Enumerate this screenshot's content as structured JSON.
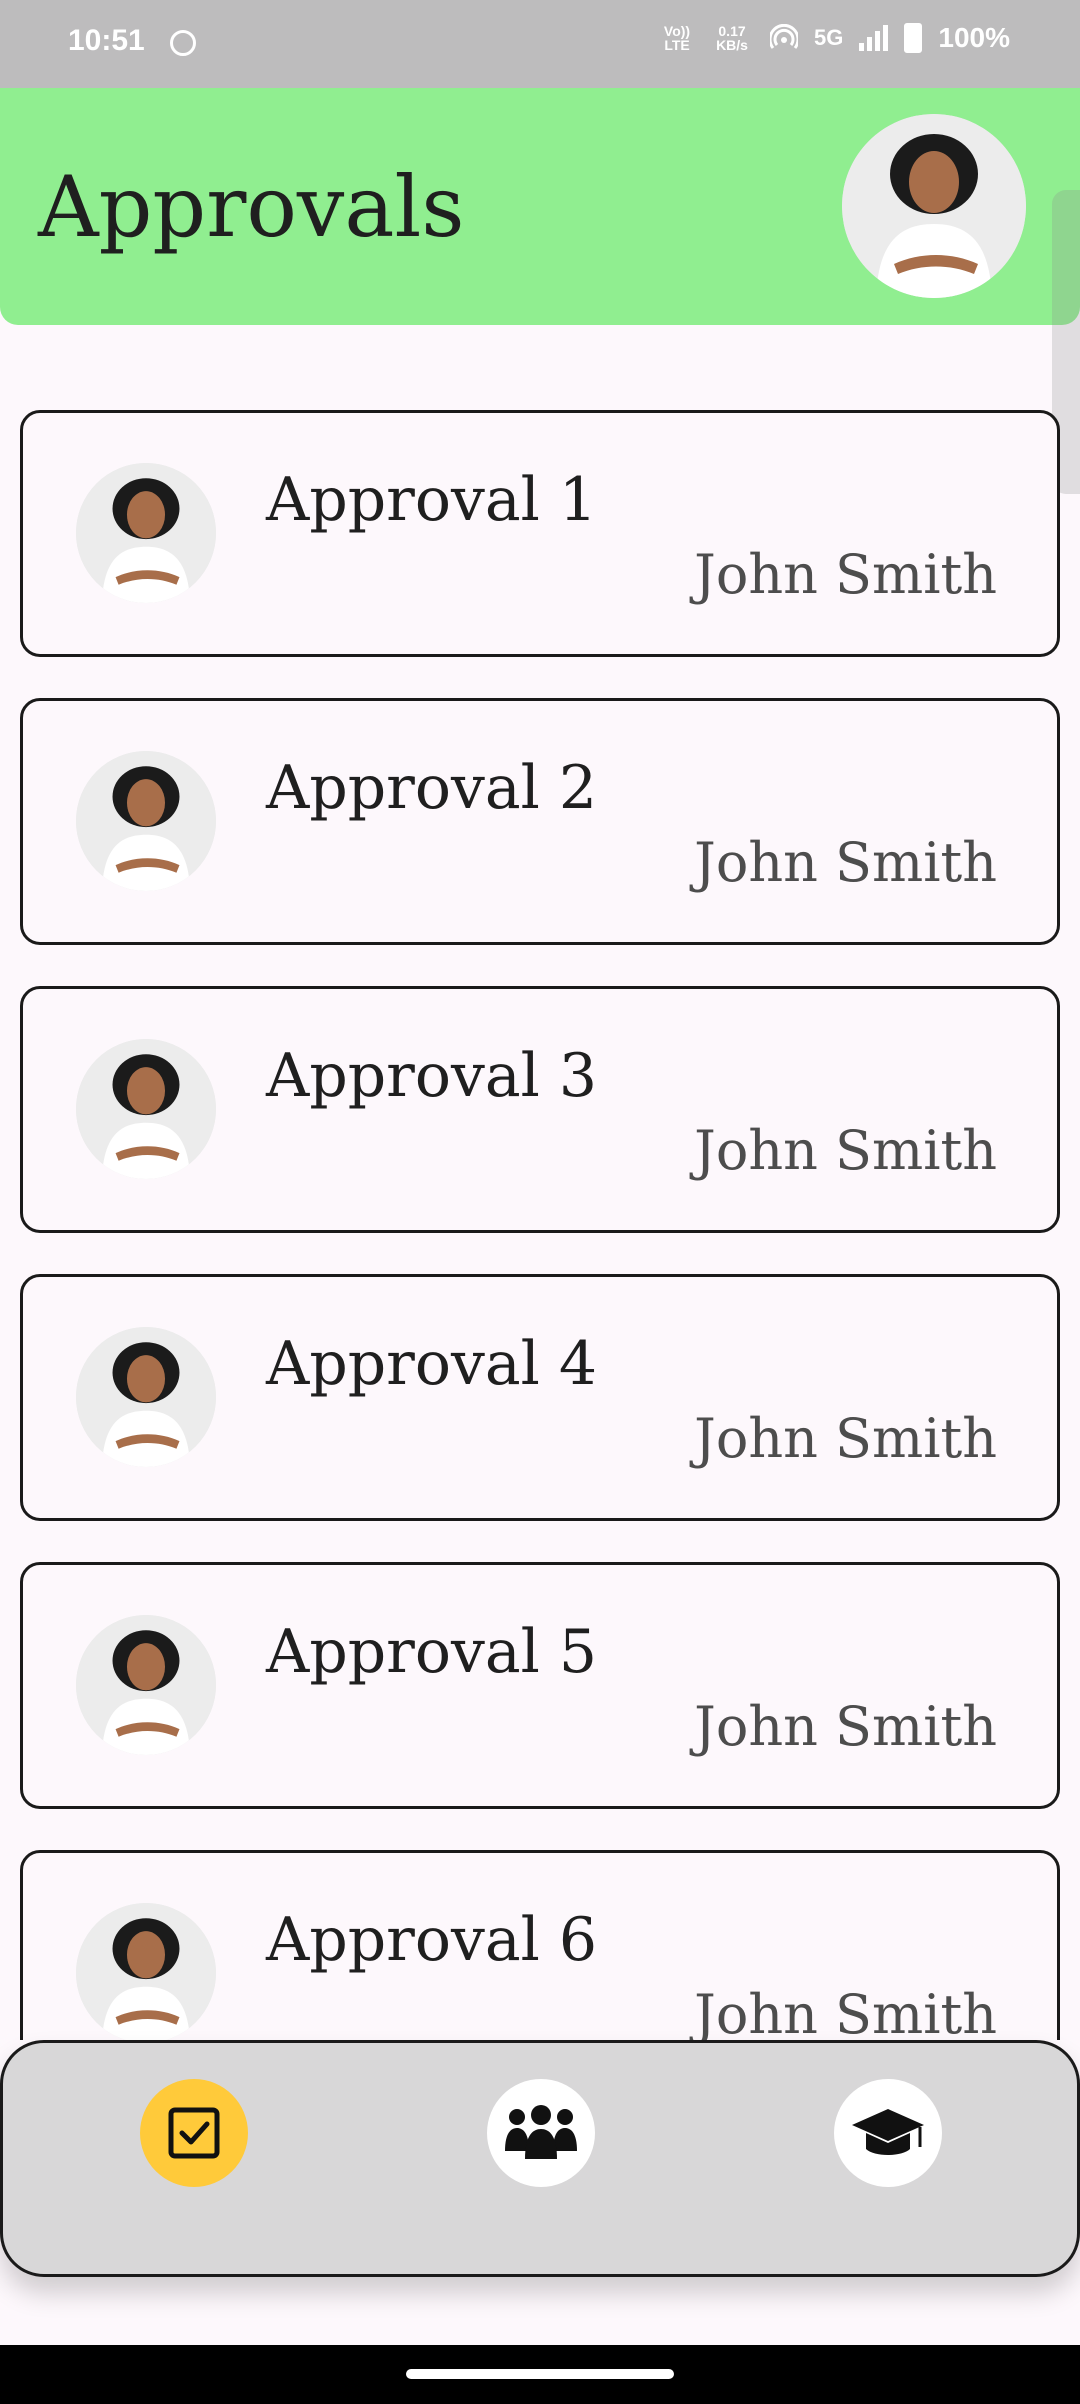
{
  "status_bar": {
    "time": "10:51",
    "volte": "Vo)) LTE",
    "data_speed": "0.17 KB/s",
    "network": "5G",
    "battery": "100%"
  },
  "header": {
    "title": "Approvals"
  },
  "approvals": [
    {
      "title": "Approval 1",
      "subtitle": "John Smith"
    },
    {
      "title": "Approval 2",
      "subtitle": "John Smith"
    },
    {
      "title": "Approval 3",
      "subtitle": "John Smith"
    },
    {
      "title": "Approval 4",
      "subtitle": "John Smith"
    },
    {
      "title": "Approval 5",
      "subtitle": "John Smith"
    },
    {
      "title": "Approval 6",
      "subtitle": "John Smith"
    }
  ],
  "bottom_nav": {
    "items": [
      {
        "icon": "checkbox-icon",
        "active": true
      },
      {
        "icon": "group-icon",
        "active": false
      },
      {
        "icon": "graduation-cap-icon",
        "active": false
      }
    ]
  },
  "colors": {
    "header_bg": "#90ee90",
    "active_nav": "#ffca3a",
    "nav_bg": "#d8d7d8"
  }
}
